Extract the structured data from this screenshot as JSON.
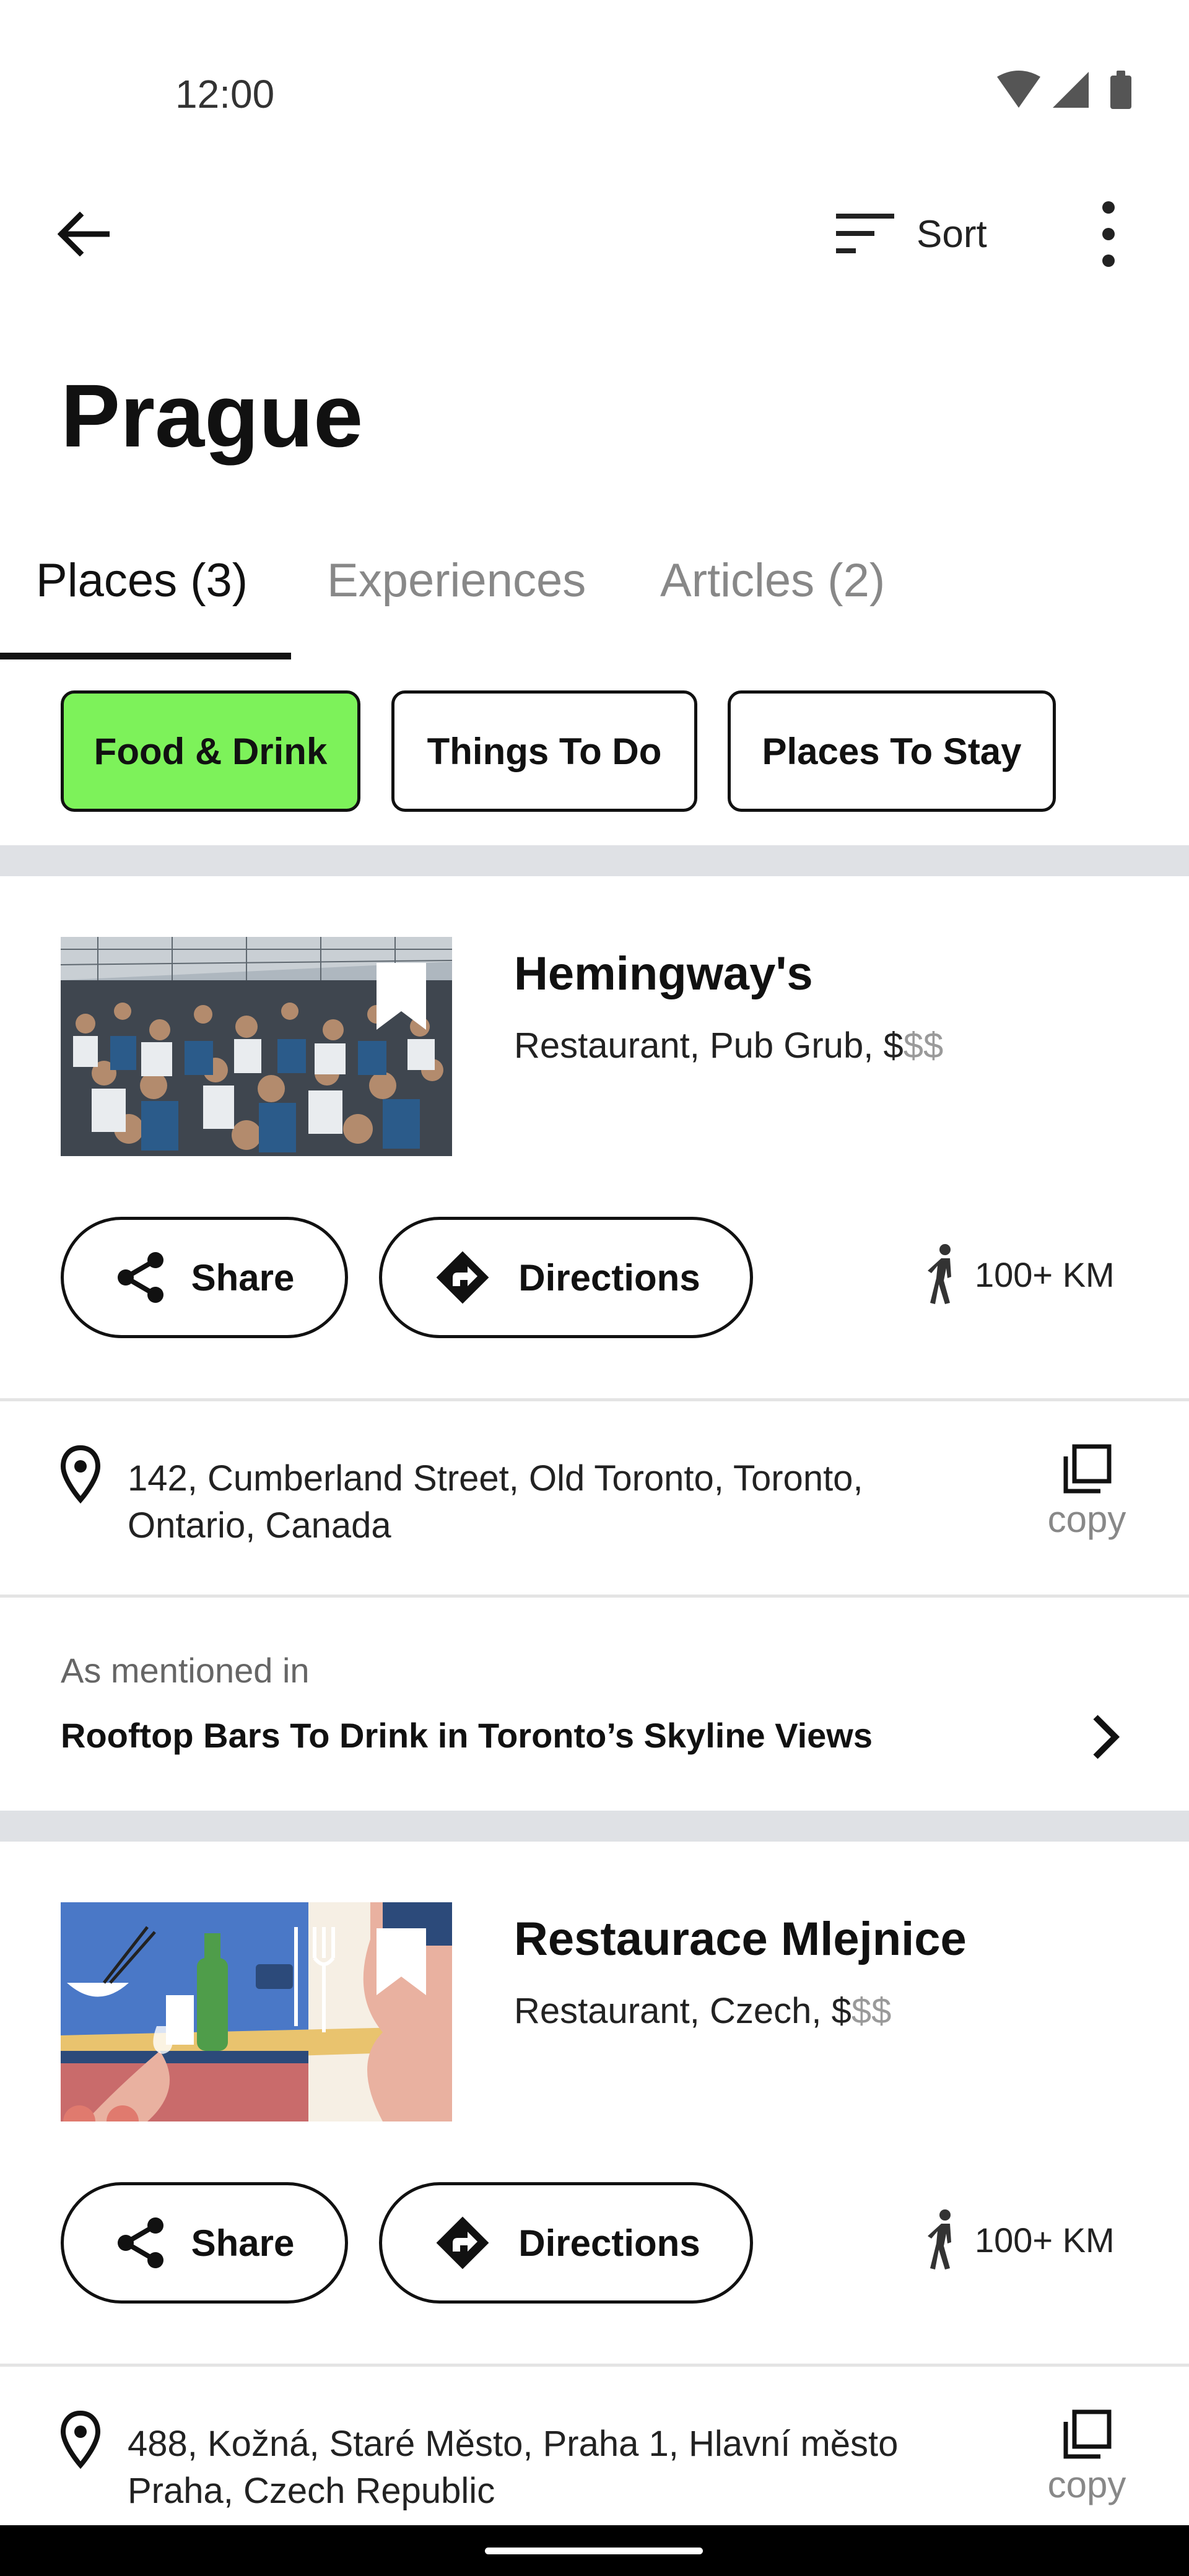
{
  "status_bar": {
    "time": "12:00",
    "icons": [
      "wifi-icon",
      "cell-signal-icon",
      "battery-icon"
    ]
  },
  "app_bar": {
    "back_icon": "arrow-left-icon",
    "sort_label": "Sort",
    "sort_icon": "sort-lines-icon",
    "more_icon": "more-vertical-icon"
  },
  "page": {
    "title": "Prague"
  },
  "tabs": [
    {
      "label": "Places (3)",
      "active": true
    },
    {
      "label": "Experiences",
      "active": false
    },
    {
      "label": "Articles (2)",
      "active": false
    }
  ],
  "filters": [
    {
      "label": "Food & Drink",
      "active": true
    },
    {
      "label": "Things To Do",
      "active": false
    },
    {
      "label": "Places To Stay",
      "active": false
    }
  ],
  "colors": {
    "active_chip": "#7df25a",
    "muted_price": "#9a9a9a",
    "band": "#dfe1e5"
  },
  "places": [
    {
      "name": "Hemingway's",
      "category": "Restaurant, Pub Grub, ",
      "price_active": "$",
      "price_muted": "$$",
      "image": "crowded-rooftop-patio-photo",
      "share_label": "Share",
      "directions_label": "Directions",
      "distance": "100+ KM",
      "address": "142, Cumberland Street, Old Toronto, Toronto, Ontario, Canada",
      "copy_label": "copy",
      "mention_label": "As mentioned in",
      "mention_title": "Rooftop Bars To Drink in Toronto’s Skyline Views"
    },
    {
      "name": "Restaurace Mlejnice",
      "category": "Restaurant, Czech, ",
      "price_active": "$",
      "price_muted": "$$",
      "image": "food-and-drink-illustration",
      "share_label": "Share",
      "directions_label": "Directions",
      "distance": "100+ KM",
      "address": "488, Kožná, Staré Město, Praha 1, Hlavní město Praha, Czech Republic",
      "copy_label": "copy"
    }
  ]
}
